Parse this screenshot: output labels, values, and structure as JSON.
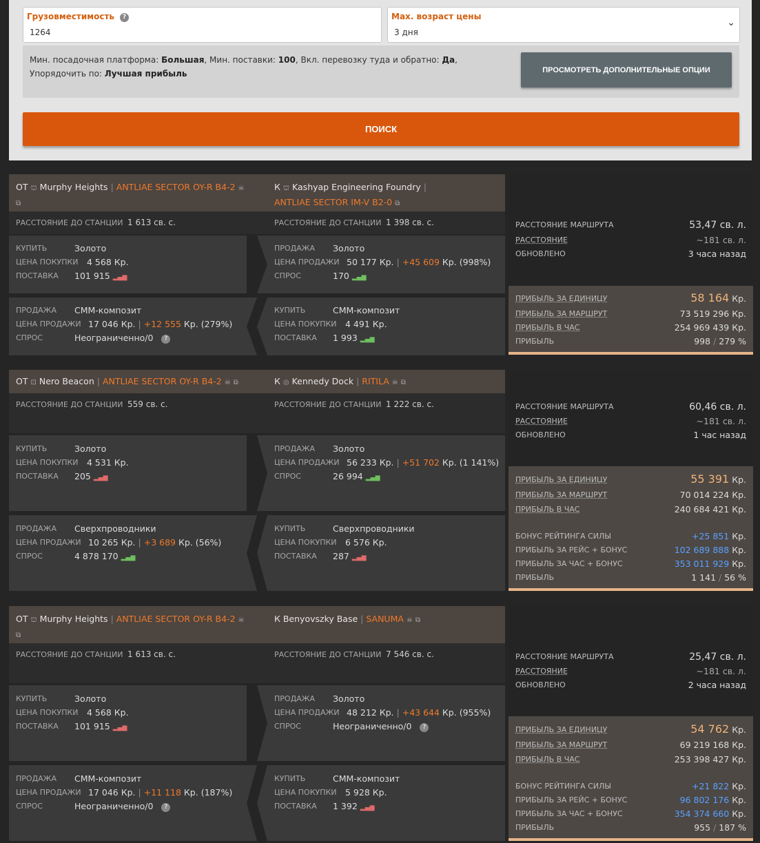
{
  "form": {
    "capacity_label": "Грузовместимость",
    "capacity_value": "1264",
    "maxage_label": "Max. возраст цены",
    "maxage_value": "3 дня",
    "summary_prefix1": "Мин. посадочная платформа: ",
    "summary_pad": "Большая",
    "summary_prefix2": ", Мин. поставки: ",
    "summary_min": "100",
    "summary_prefix3": ", Вкл. перевозку туда и обратно: ",
    "summary_round": "Да",
    "summary_prefix4": ", Упорядочить по: ",
    "summary_sort": "Лучшая прибыль",
    "more_button": "ПРОСМОТРЕТЬ ДОПОЛНИТЕЛЬНЫЕ ОПЦИИ",
    "search_button": "ПОИСК"
  },
  "labels": {
    "from": "ОТ",
    "to": "К",
    "dist_station": "РАССТОЯНИЕ ДО СТАНЦИИ",
    "buy": "КУПИТЬ",
    "sell": "ПРОДАЖА",
    "buy_price": "ЦЕНА ПОКУПКИ",
    "sell_price": "ЦЕНА ПРОДАЖИ",
    "supply": "ПОСТАВКА",
    "demand": "СПРОС",
    "route_dist": "РАССТОЯНИЕ МАРШРУТА",
    "dist": "РАССТОЯНИЕ",
    "updated": "ОБНОВЛЕНО",
    "profit_unit": "ПРИБЫЛЬ ЗА ЕДИНИЦУ",
    "profit_route": "ПРИБЫЛЬ ЗА МАРШРУТ",
    "profit_hour": "ПРИБЫЛЬ В ЧАС",
    "profit": "ПРИБЫЛЬ",
    "power_bonus": "БОНУС РЕЙТИНГА СИЛЫ",
    "profit_trip_bonus": "ПРИБЫЛЬ ЗА РЕЙС + БОНУС",
    "profit_hour_bonus": "ПРИБЫЛЬ ЗА ЧАС + БОНУС",
    "cr": "Кр."
  },
  "routes": [
    {
      "from_station": "Murphy Heights",
      "from_system": "ANTLIAE SECTOR OY-R B4-2",
      "to_station": "Kashyap Engineering Foundry",
      "to_system": "ANTLIAE SECTOR IM-V B2-0",
      "from_dist": "1 613 св. с.",
      "to_dist": "1 398 св. с.",
      "out": {
        "commodity": "Золото",
        "buy_price": "4 568",
        "supply": "101 915",
        "sell_commodity": "Золото",
        "sell_price": "50 177",
        "profit": "+45 609",
        "pct": "(998%)",
        "demand": "170"
      },
      "back": {
        "commodity": "СММ-композит",
        "sell_price": "17 046",
        "profit": "+12 555",
        "pct": "(279%)",
        "demand": "Неограниченно/0",
        "buy_commodity": "СММ-композит",
        "buy_price": "4 491",
        "supply": "1 993"
      },
      "side": {
        "route_dist": "53,47 св. л.",
        "dist": "~181 св. л.",
        "updated": "3 часа назад",
        "profit_unit": "58 164",
        "profit_route": "73 519 296 Кр.",
        "profit_hour": "254 969 439 Кр.",
        "profit_total": "998",
        "profit_pct": "279 %"
      }
    },
    {
      "from_station": "Nero Beacon",
      "from_system": "ANTLIAE SECTOR OY-R B4-2",
      "to_station": "Kennedy Dock",
      "to_system": "RITILA",
      "from_dist": "559 св. с.",
      "to_dist": "1 222 св. с.",
      "out": {
        "commodity": "Золото",
        "buy_price": "4 531",
        "supply": "205",
        "sell_commodity": "Золото",
        "sell_price": "56 233",
        "profit": "+51 702",
        "pct": "(1 141%)",
        "demand": "26 994"
      },
      "back": {
        "commodity": "Сверхпроводники",
        "sell_price": "10 265",
        "profit": "+3 689",
        "pct": "(56%)",
        "demand": "4 878 170",
        "buy_commodity": "Сверхпроводники",
        "buy_price": "6 576",
        "supply": "287"
      },
      "side": {
        "route_dist": "60,46 св. л.",
        "dist": "~181 св. л.",
        "updated": "1 час назад",
        "profit_unit": "55 391",
        "profit_route": "70 014 224 Кр.",
        "profit_hour": "240 684 421 Кр.",
        "power_bonus": "+25 851",
        "profit_trip_bonus": "102 689 888",
        "profit_hour_bonus": "353 011 929",
        "profit_total": "1 141",
        "profit_pct": "56 %"
      }
    },
    {
      "from_station": "Murphy Heights",
      "from_system": "ANTLIAE SECTOR OY-R B4-2",
      "to_station": "Benyovszky Base",
      "to_system": "SANUMA",
      "from_dist": "1 613 св. с.",
      "to_dist": "7 546 св. с.",
      "out": {
        "commodity": "Золото",
        "buy_price": "4 568",
        "supply": "101 915",
        "sell_commodity": "Золото",
        "sell_price": "48 212",
        "profit": "+43 644",
        "pct": "(955%)",
        "demand": "Неограниченно/0"
      },
      "back": {
        "commodity": "СММ-композит",
        "sell_price": "17 046",
        "profit": "+11 118",
        "pct": "(187%)",
        "demand": "Неограниченно/0",
        "buy_commodity": "СММ-композит",
        "buy_price": "5 928",
        "supply": "1 392"
      },
      "side": {
        "route_dist": "25,47 св. л.",
        "dist": "~181 св. л.",
        "updated": "2 часа назад",
        "profit_unit": "54 762",
        "profit_route": "69 219 168 Кр.",
        "profit_hour": "253 398 427 Кр.",
        "power_bonus": "+21 822",
        "profit_trip_bonus": "96 802 176",
        "profit_hour_bonus": "354 374 660",
        "profit_total": "955",
        "profit_pct": "187 %"
      }
    }
  ]
}
